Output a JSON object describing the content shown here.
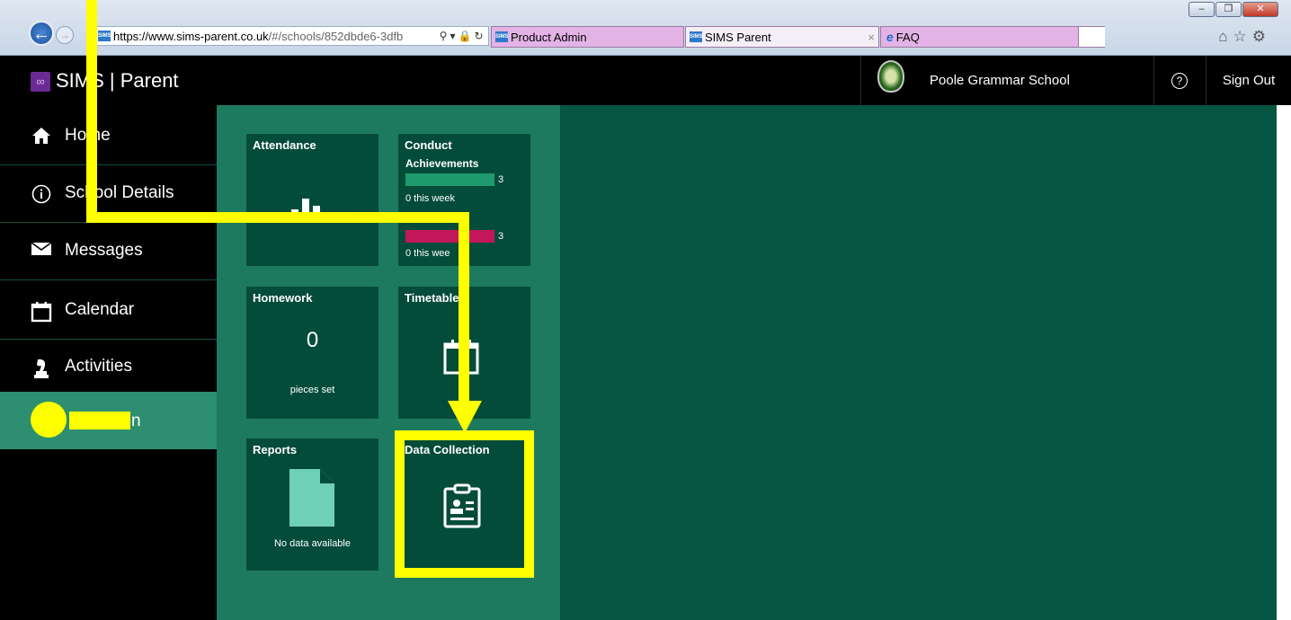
{
  "browser": {
    "url_host": "https://www.sims-parent.co.uk",
    "url_path": "/#/schools/852dbde6-3dfb",
    "favicon_text": "SIMS",
    "tabs": [
      {
        "label": "Product Admin"
      },
      {
        "label": "SIMS Parent"
      },
      {
        "label": "FAQ"
      }
    ],
    "tab_close": "×"
  },
  "header": {
    "app_title": "SIMS | Parent",
    "school_name": "Poole Grammar School",
    "help": "?",
    "sign_out": "Sign Out"
  },
  "sidebar": {
    "items": [
      {
        "label": "Home",
        "icon": "home-icon"
      },
      {
        "label": "School Details",
        "icon": "info-icon"
      },
      {
        "label": "Messages",
        "icon": "envelope-icon"
      },
      {
        "label": "Calendar",
        "icon": "calendar-icon"
      },
      {
        "label": "Activities",
        "icon": "chess-piece-icon"
      },
      {
        "label": "n",
        "icon": "student-icon"
      }
    ]
  },
  "tiles": {
    "attendance": {
      "title": "Attendance"
    },
    "conduct": {
      "title": "Conduct",
      "achievements_label": "Achievements",
      "achievements_count": "3",
      "achievements_week": "0 this week",
      "behaviour_count": "3",
      "behaviour_week": "0 this wee"
    },
    "homework": {
      "title": "Homework",
      "count": "0",
      "caption": "pieces set"
    },
    "timetable": {
      "title": "Timetable"
    },
    "reports": {
      "title": "Reports",
      "caption": "No data available"
    },
    "data_collection": {
      "title": "Data Collection"
    }
  },
  "colors": {
    "achievements_bar": "#1e9b6e",
    "behaviour_bar": "#c2185b",
    "annotation": "#ffff00",
    "panel": "#1e7a5e",
    "tile": "#044c3a",
    "content": "#045541"
  }
}
